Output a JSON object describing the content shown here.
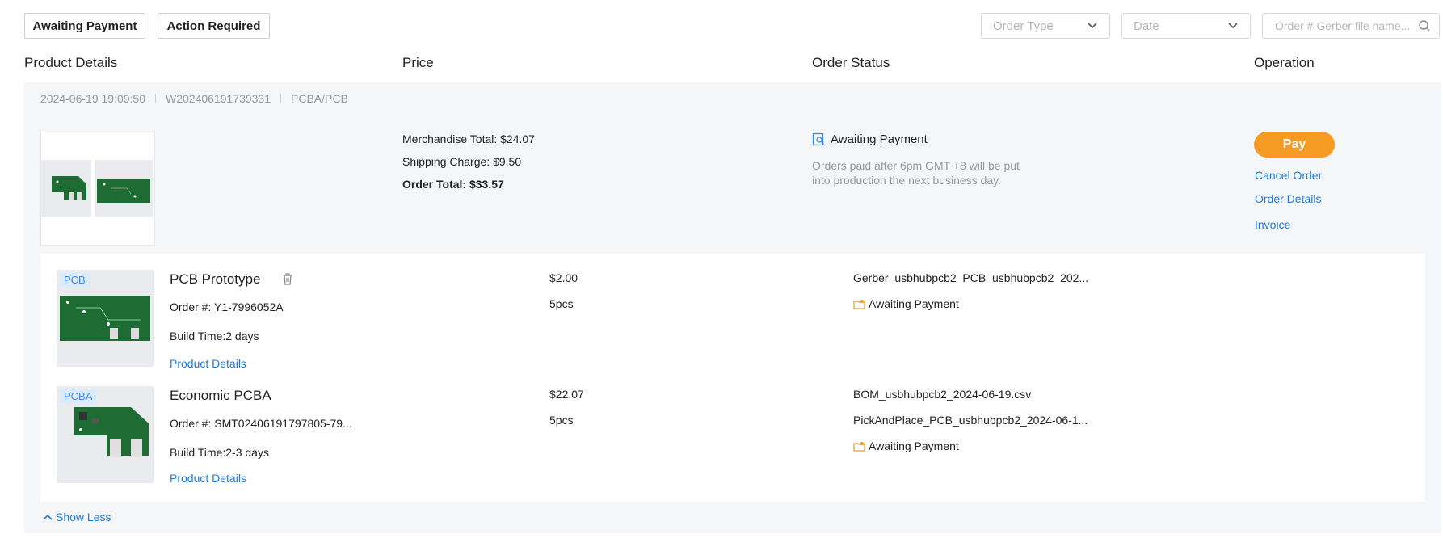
{
  "filters": {
    "awaiting_payment": "Awaiting Payment",
    "action_required": "Action Required",
    "order_type_placeholder": "Order Type",
    "date_placeholder": "Date",
    "search_placeholder": "Order #,Gerber file name..."
  },
  "columns": {
    "product_details": "Product Details",
    "price": "Price",
    "order_status": "Order Status",
    "operation": "Operation"
  },
  "order": {
    "date": "2024-06-19 19:09:50",
    "number": "W202406191739331",
    "type": "PCBA/PCB",
    "merchandise_total": "Merchandise Total: $24.07",
    "shipping_charge": "Shipping Charge: $9.50",
    "order_total": "Order Total: $33.57",
    "status": "Awaiting Payment",
    "status_note_line1": "Orders paid after 6pm GMT +8 will be put",
    "status_note_line2": "into production the next business day.",
    "pay": "Pay",
    "cancel": "Cancel Order",
    "details": "Order Details",
    "invoice": "Invoice"
  },
  "items": [
    {
      "tag": "PCB",
      "title": "PCB Prototype",
      "order_no": "Order #: Y1-7996052A",
      "build_time": "Build Time:2 days",
      "details_link": "Product Details",
      "price": "$2.00",
      "qty": "5pcs",
      "files": [
        "Gerber_usbhubpcb2_PCB_usbhubpcb2_202..."
      ],
      "status": "Awaiting Payment"
    },
    {
      "tag": "PCBA",
      "title": "Economic PCBA",
      "order_no": "Order #: SMT02406191797805-79...",
      "build_time": "Build Time:2-3 days",
      "details_link": "Product Details",
      "price": "$22.07",
      "qty": "5pcs",
      "files": [
        "BOM_usbhubpcb2_2024-06-19.csv",
        "PickAndPlace_PCB_usbhubpcb2_2024-06-1..."
      ],
      "status": "Awaiting Payment"
    }
  ],
  "show_less": "Show Less",
  "colors": {
    "accent": "#1f7ad6",
    "pay": "#f59a23",
    "pcb_green": "#1e6b33"
  }
}
